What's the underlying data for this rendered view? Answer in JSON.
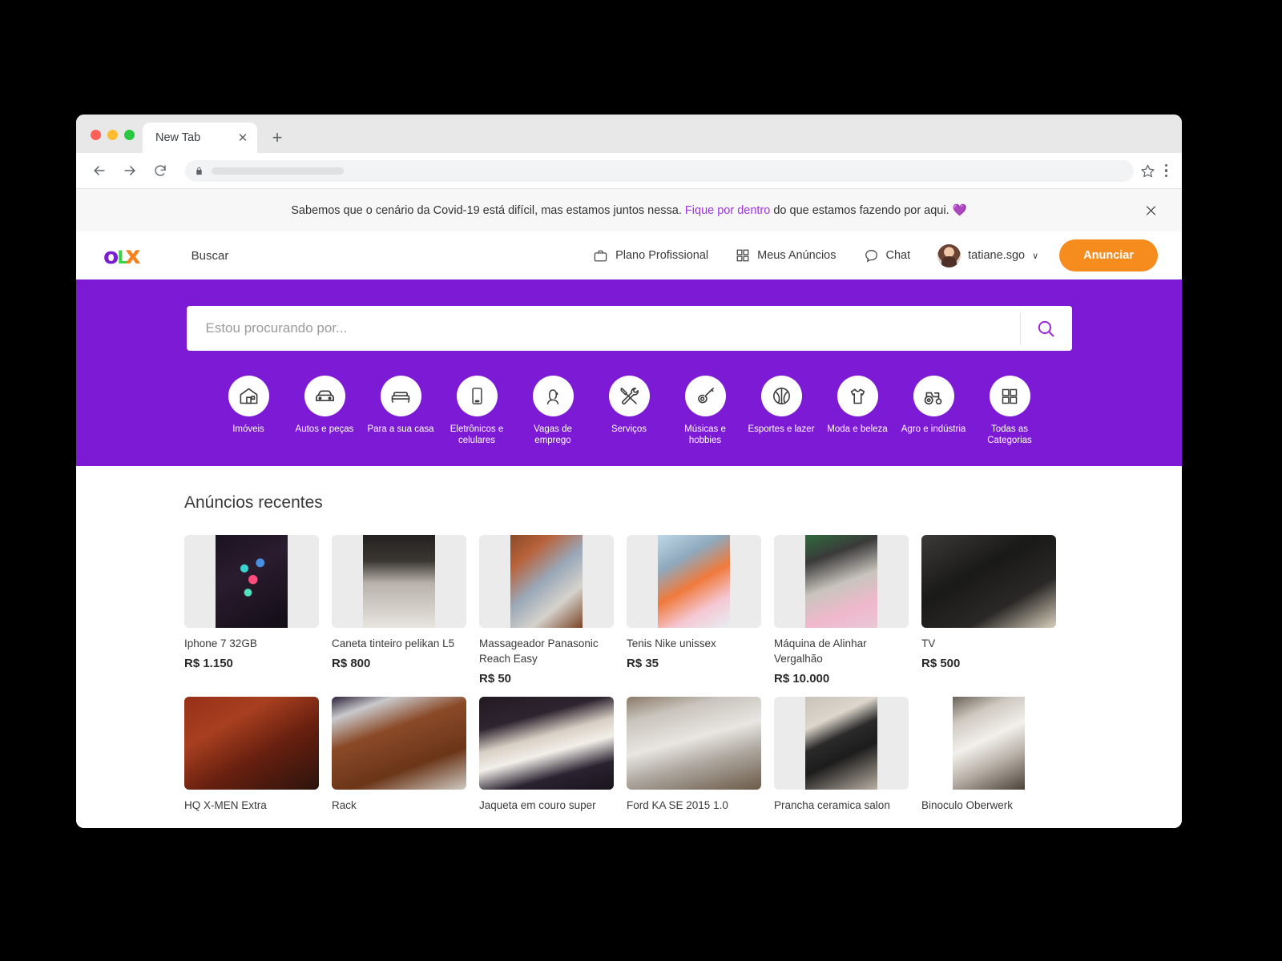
{
  "browser": {
    "tab_title": "New Tab",
    "tab_close_label": "✕",
    "new_tab_label": "+",
    "url_value": ""
  },
  "covid_banner": {
    "text_before": "Sabemos que o cenário da Covid-19 está difícil, mas estamos juntos nessa. ",
    "link": "Fique por dentro",
    "text_after": " do que estamos fazendo por aqui. ",
    "heart": "💜",
    "link_color": "#a033e0"
  },
  "header": {
    "logo": {
      "o": "o",
      "l": "L",
      "x": "x"
    },
    "buscar": "Buscar",
    "links": [
      {
        "label": "Plano Profissional",
        "icon": "briefcase-icon"
      },
      {
        "label": "Meus Anúncios",
        "icon": "grid-icon"
      },
      {
        "label": "Chat",
        "icon": "chat-bubble-icon"
      }
    ],
    "user": {
      "name": "tatiane.sgo",
      "caret": "∨"
    },
    "announce_button": "Anunciar",
    "announce_color": "#f68b1e"
  },
  "hero": {
    "background_color": "#7d1ad6",
    "search_placeholder": "Estou procurando por...",
    "search_value": "",
    "search_icon": "search-icon",
    "categories": [
      {
        "label": "Imóveis",
        "icon": "house-icon"
      },
      {
        "label": "Autos e peças",
        "icon": "car-icon"
      },
      {
        "label": "Para a sua casa",
        "icon": "bed-icon"
      },
      {
        "label": "Eletrônicos e celulares",
        "icon": "smartphone-icon"
      },
      {
        "label": "Vagas de emprego",
        "icon": "person-icon"
      },
      {
        "label": "Serviços",
        "icon": "tools-icon"
      },
      {
        "label": "Músicas e hobbies",
        "icon": "guitar-icon"
      },
      {
        "label": "Esportes e lazer",
        "icon": "basketball-icon"
      },
      {
        "label": "Moda e beleza",
        "icon": "shirt-icon"
      },
      {
        "label": "Agro e indústria",
        "icon": "tractor-icon"
      },
      {
        "label": "Todas as Categorias",
        "icon": "grid-icon"
      }
    ]
  },
  "listings": {
    "title": "Anúncios recentes",
    "products": [
      {
        "title": "Iphone 7 32GB",
        "price": "R$ 1.150",
        "art": "img-iphone",
        "fit": "narrow",
        "bg": true
      },
      {
        "title": "Caneta tinteiro pelikan L5",
        "price": "R$ 800",
        "art": "img-caneta",
        "fit": "narrow",
        "bg": true
      },
      {
        "title": "Massageador Panasonic Reach Easy",
        "price": "R$ 50",
        "art": "img-massage",
        "fit": "narrow",
        "bg": true
      },
      {
        "title": "Tenis Nike unissex",
        "price": "R$ 35",
        "art": "img-tenis",
        "fit": "narrow",
        "bg": true
      },
      {
        "title": "Máquina de Alinhar Vergalhão",
        "price": "R$ 10.000",
        "art": "img-maquina",
        "fit": "narrow",
        "bg": true
      },
      {
        "title": "TV",
        "price": "R$ 500",
        "art": "img-tv",
        "fit": "wide",
        "bg": true
      },
      {
        "title": "HQ X-MEN Extra",
        "price": "",
        "art": "img-hq",
        "fit": "wide",
        "bg": true
      },
      {
        "title": "Rack",
        "price": "",
        "art": "img-rack",
        "fit": "wide",
        "bg": true
      },
      {
        "title": "Jaqueta em couro super",
        "price": "",
        "art": "img-jaqueta",
        "fit": "wide",
        "bg": true
      },
      {
        "title": "Ford KA SE 2015 1.0",
        "price": "",
        "art": "img-ford",
        "fit": "wide",
        "bg": true
      },
      {
        "title": "Prancha ceramica salon",
        "price": "",
        "art": "img-prancha",
        "fit": "narrow",
        "bg": true
      },
      {
        "title": "Binoculo Oberwerk",
        "price": "",
        "art": "img-binoculo",
        "fit": "narrow",
        "bg": false
      }
    ]
  }
}
